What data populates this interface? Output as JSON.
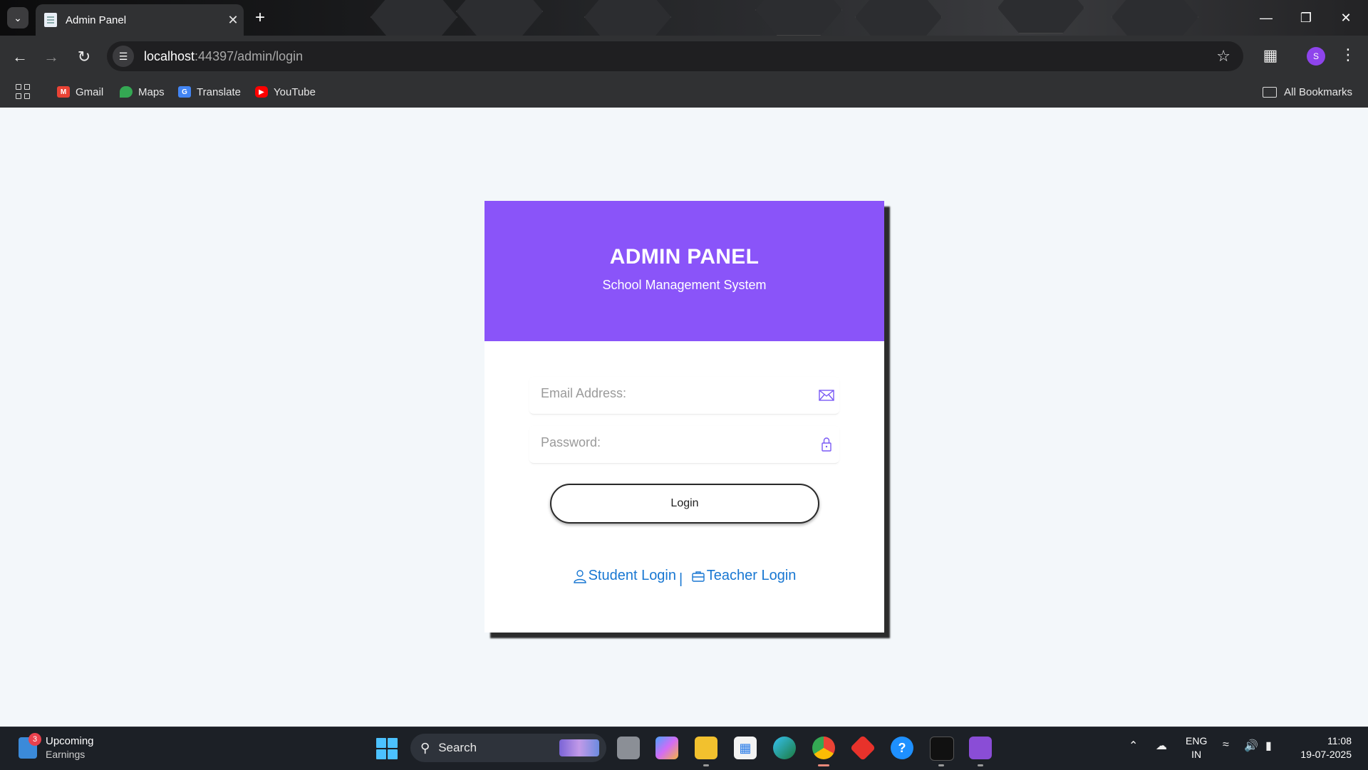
{
  "browser": {
    "tab_title": "Admin Panel",
    "url_host": "localhost",
    "url_rest": ":44397/admin/login",
    "profile_initial": "S",
    "bookmarks": [
      {
        "label": "Gmail",
        "icon": "gmail-icon",
        "color": "#ea4335"
      },
      {
        "label": "Maps",
        "icon": "maps-icon",
        "color": "#34a853"
      },
      {
        "label": "Translate",
        "icon": "translate-icon",
        "color": "#4285f4"
      },
      {
        "label": "YouTube",
        "icon": "youtube-icon",
        "color": "#ff0000"
      }
    ],
    "all_bookmarks": "All Bookmarks"
  },
  "login": {
    "title": "ADMIN PANEL",
    "subtitle": "School Management System",
    "email_placeholder": "Email Address:",
    "password_placeholder": "Password:",
    "login_button": "Login",
    "student_link": "Student Login",
    "separator": "|",
    "teacher_link": "Teacher Login",
    "accent_color": "#8a54f9",
    "link_color": "#1877d2"
  },
  "taskbar": {
    "weather_badge": "3",
    "weather_line1": "Upcoming",
    "weather_line2": "Earnings",
    "search_label": "Search",
    "lang_line1": "ENG",
    "lang_line2": "IN",
    "time": "11:08",
    "date": "19-07-2025"
  }
}
